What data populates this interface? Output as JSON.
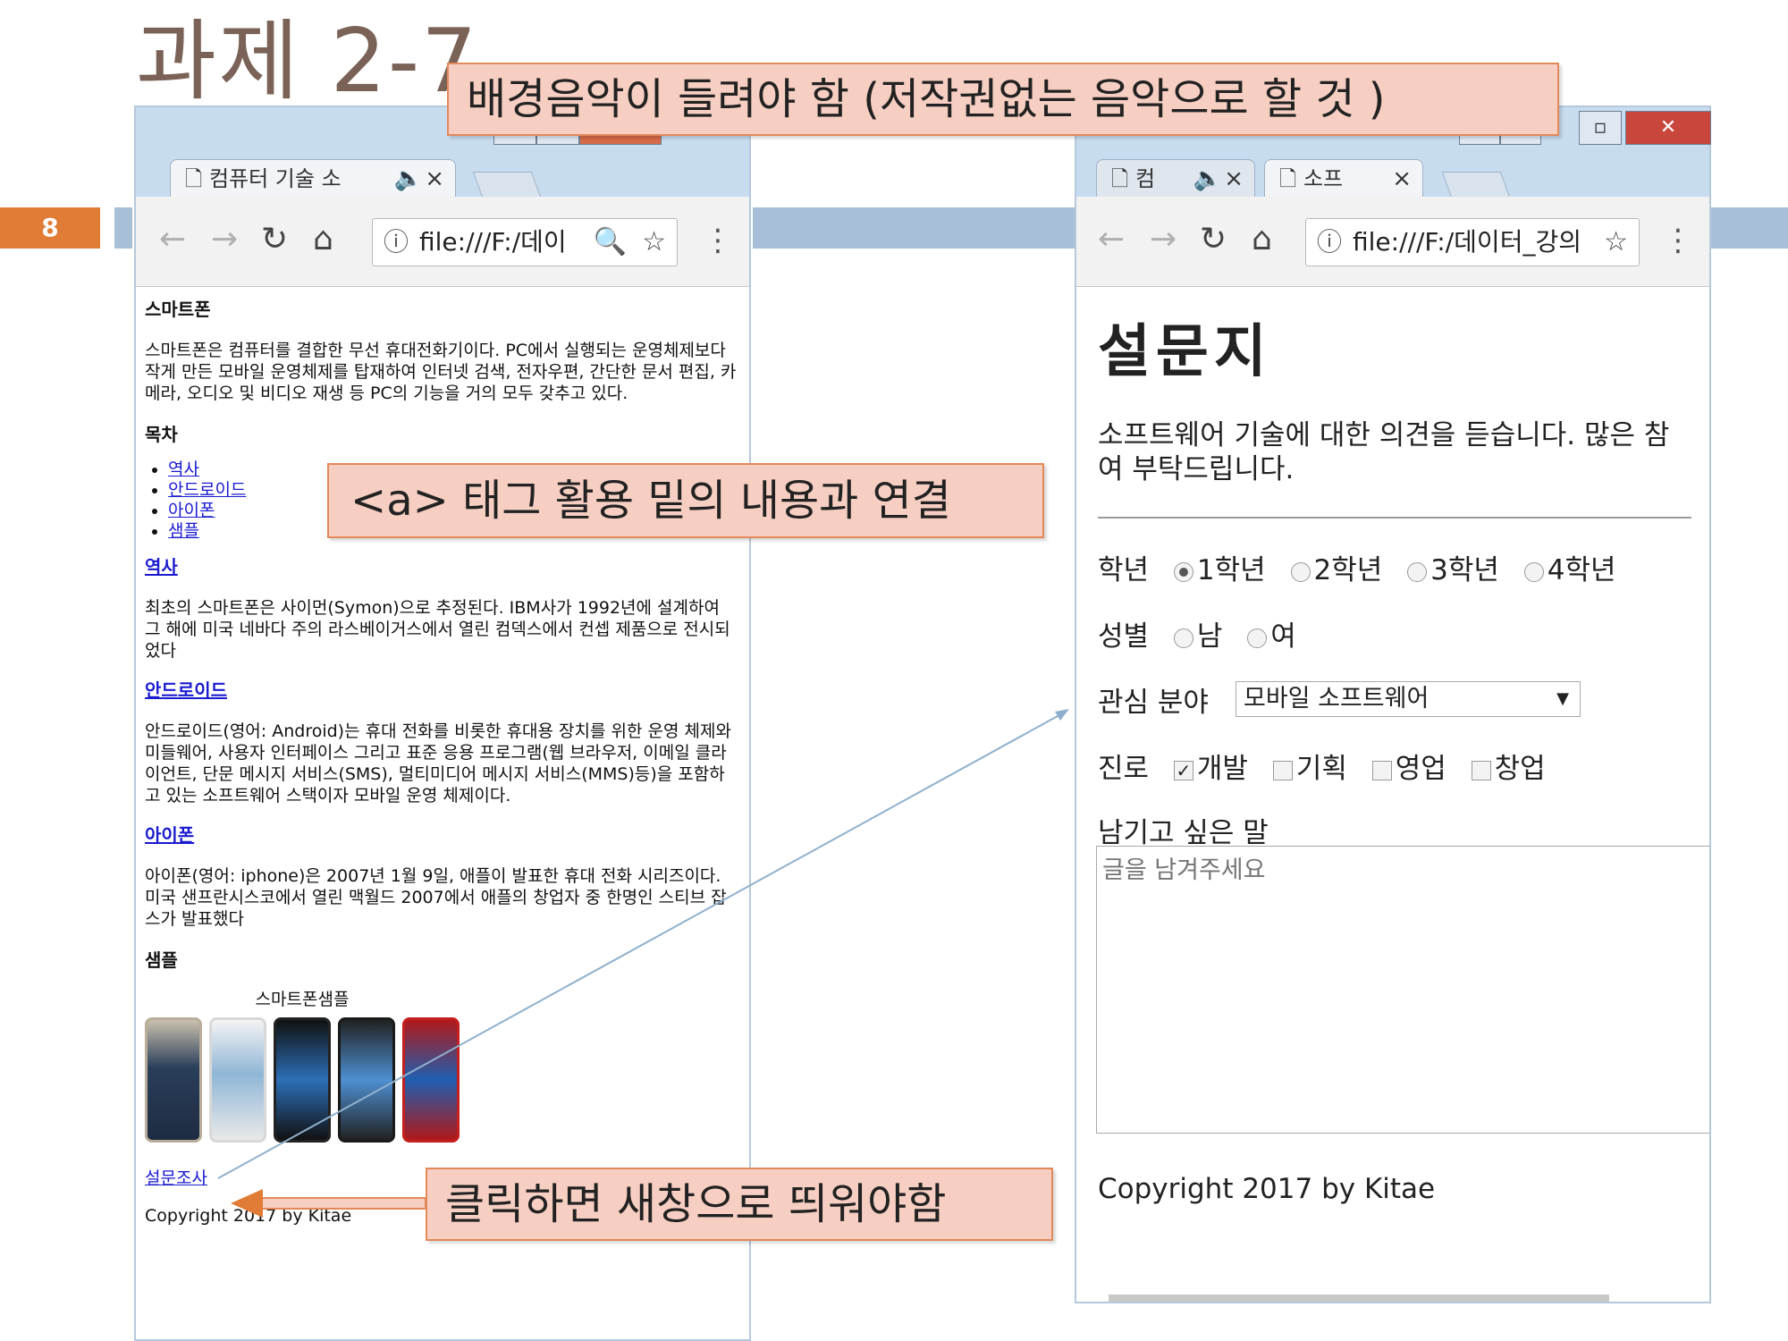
{
  "slide": {
    "title": "과제 2-7",
    "page_number": "8",
    "accent_color": "#e07c36",
    "band_color": "#a7c0d8"
  },
  "callouts": {
    "top": "배경음악이 들려야 함 (저작권없는 음악으로 할 것 )",
    "middle": "<a> 태그 활용  밑의 내용과 연결",
    "bottom": "클릭하면 새창으로 띄워야함"
  },
  "left_window": {
    "tab_title": "컴퓨터 기술 소",
    "address": "file:///F:/데이",
    "page": {
      "heading": "스마트폰",
      "intro": "스마트폰은 컴퓨터를 결합한 무선 휴대전화기이다. PC에서 실행되는 운영체제보다 작게 만든 모바일 운영체제를 탑재하여 인터넷 검색, 전자우편, 간단한 문서 편집, 카메라, 오디오 및 비디오 재생 등 PC의 기능을 거의 모두 갖추고 있다.",
      "toc_heading": "목차",
      "toc": [
        "역사",
        "안드로이드",
        "아이폰",
        "샘플"
      ],
      "sections": [
        {
          "title": "역사",
          "body": "최초의 스마트폰은 사이먼(Symon)으로 추정된다. IBM사가 1992년에 설계하여 그 해에 미국 네바다 주의 라스베이거스에서 열린 컴덱스에서 컨셉 제품으로 전시되었다"
        },
        {
          "title": "안드로이드",
          "body": "안드로이드(영어: Android)는 휴대 전화를 비롯한 휴대용 장치를 위한 운영 체제와 미들웨어, 사용자 인터페이스 그리고 표준 응용 프로그램(웹 브라우저, 이메일 클라이언트, 단문 메시지 서비스(SMS), 멀티미디어 메시지 서비스(MMS)등)을 포함하고 있는 소프트웨어 스택이자 모바일 운영 체제이다."
        },
        {
          "title": "아이폰",
          "body": "아이폰(영어: iphone)은 2007년 1월 9일, 애플이 발표한 휴대 전화 시리즈이다. 미국 샌프란시스코에서 열린 맥월드 2007에서 애플의 창업자 중 한명인 스티브 잡스가 발표했다"
        }
      ],
      "sample_heading": "샘플",
      "caption": "스마트폰샘플",
      "survey_link": "설문조사",
      "copyright": "Copyright 2017 by Kitae"
    }
  },
  "right_window": {
    "tabs": [
      {
        "label": "컴"
      },
      {
        "label": "소프"
      }
    ],
    "address": "file:///F:/데이터_강의",
    "page": {
      "title": "설문지",
      "intro": "소프트웨어 기술에 대한 의견을 듣습니다. 많은 참여 부탁드립니다.",
      "grade": {
        "label": "학년",
        "options": [
          "1학년",
          "2학년",
          "3학년",
          "4학년"
        ],
        "selected": 0
      },
      "gender": {
        "label": "성별",
        "options": [
          "남",
          "여"
        ]
      },
      "interest": {
        "label": "관심 분야",
        "selected": "모바일 소프트웨어"
      },
      "career": {
        "label": "진로",
        "options": [
          "개발",
          "기획",
          "영업",
          "창업"
        ],
        "checked": [
          0
        ]
      },
      "comment": {
        "label": "남기고 싶은 말",
        "placeholder": "글을 남겨주세요"
      },
      "copyright": "Copyright 2017 by Kitae"
    }
  }
}
